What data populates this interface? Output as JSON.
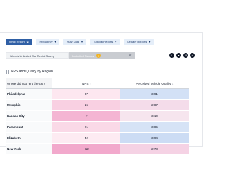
{
  "toolbar": {
    "items": [
      {
        "label": "Omni Report",
        "icon": "external-link-icon"
      },
      {
        "label": "Frequency"
      },
      {
        "label": "Raw Data"
      },
      {
        "label": "Special Reports"
      },
      {
        "label": "Legacy Reports"
      }
    ],
    "colors": {
      "primary": "#2f5fa5",
      "secondary_bg": "#e5eef9"
    }
  },
  "tabs": [
    {
      "label": "Wheels Unlimited Car Rental Survey"
    },
    {
      "label": "Unlimited Canvas",
      "badge": "!"
    }
  ],
  "actions": [
    "info-icon",
    "filter-icon",
    "share-icon",
    "add-icon"
  ],
  "card": {
    "title": "NPS and Quality by Region"
  },
  "table": {
    "headers": {
      "region": "Where did you rent the car?",
      "nps": "NPS",
      "quality": "Perceived Vehicle Quality"
    },
    "rows": [
      {
        "region": "Philadelphia",
        "nps": "37",
        "quality": "3.91",
        "nps_color": "#fde7f0",
        "quality_color": "#d3e1f6"
      },
      {
        "region": "Memphis",
        "nps": "15",
        "quality": "2.87",
        "nps_color": "#f9d0e2",
        "quality_color": "#f4dcea"
      },
      {
        "region": "Kansas City",
        "nps": "-7",
        "quality": "3.10",
        "nps_color": "#f4b5d3",
        "quality_color": "#f6e5ee"
      },
      {
        "region": "Paramount",
        "nps": "21",
        "quality": "3.85",
        "nps_color": "#fad9e7",
        "quality_color": "#d6e3f6"
      },
      {
        "region": "Elizabeth",
        "nps": "42",
        "quality": "3.94",
        "nps_color": "#fdebf2",
        "quality_color": "#ccdcf4"
      },
      {
        "region": "New York",
        "nps": "-12",
        "quality": "2.78",
        "nps_color": "#f2a9cc",
        "quality_color": "#f5d2e4"
      }
    ]
  }
}
